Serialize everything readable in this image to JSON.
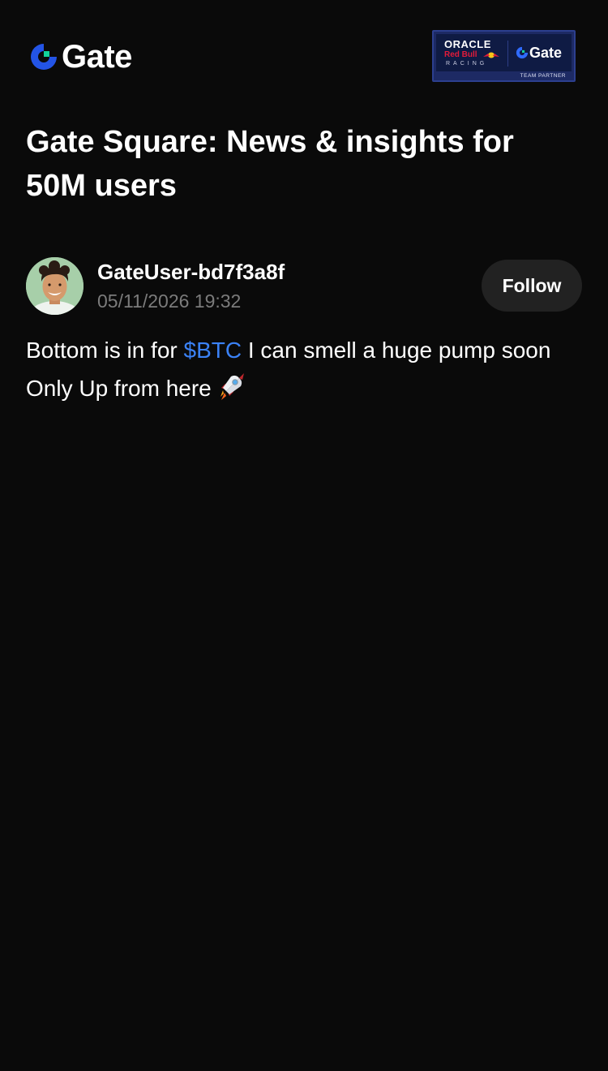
{
  "header": {
    "brand_name": "Gate",
    "brand_color": "#2354e6",
    "brand_accent": "#12d29b",
    "partner": {
      "oracle": "ORACLE",
      "redbull": "Red Bull",
      "racing": "RACING",
      "gate": "Gate",
      "team_partner": "TEAM PARTNER"
    }
  },
  "headline": "Gate Square: News & insights for 50M users",
  "author": {
    "name": "GateUser-bd7f3a8f",
    "time": "05/11/2026 19:32",
    "follow_label": "Follow"
  },
  "post": {
    "text_before": "Bottom is in for ",
    "ticker": "$BTC",
    "text_after": "   I can smell a huge pump soon  Only Up from here",
    "ticker_color": "#3b82f6",
    "emoji_icon": "rocket-icon"
  }
}
